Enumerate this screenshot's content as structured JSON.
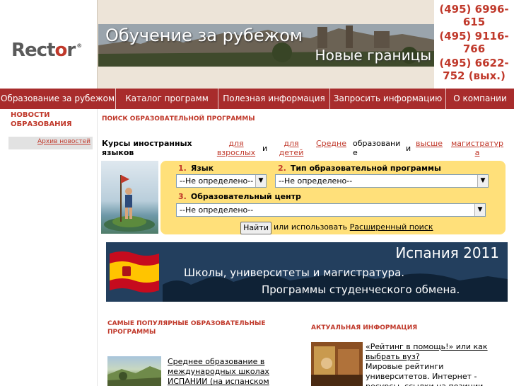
{
  "header": {
    "logo_text": "Rector",
    "banner_title": "Обучение за рубежом",
    "banner_subtitle": "Новые границы",
    "phones": [
      "(495) 6996-615",
      "(495) 9116-766",
      "(495) 6622-752 (вых.)"
    ]
  },
  "nav": {
    "items": [
      "Образование за рубежом",
      "Каталог программ",
      "Полезная информация",
      "Запросить информацию",
      "О компании"
    ]
  },
  "sidebar": {
    "news_title": "НОВОСТИ ОБРАЗОВАНИЯ",
    "archive_link": "Архив новостей"
  },
  "search": {
    "title": "ПОИСК ОБРАЗОВАТЕЛЬНОЙ ПРОГРАММЫ",
    "courses_label": "Курсы иностранных языков",
    "link_adults": "для взрослых",
    "and1": "и",
    "link_children": "для детей",
    "link_secondary": "Средне",
    "education_word": "образовани е",
    "and2": "и",
    "link_higher": "высше",
    "link_masters": "магистратур а",
    "field1_num": "1.",
    "field1_label": "Язык",
    "field1_value": "--Не определено--",
    "field2_num": "2.",
    "field2_label": "Тип образовательной программы",
    "field2_value": "--Не определено--",
    "field3_num": "3.",
    "field3_label": "Образовательный центр",
    "field3_value": "--Не определено--",
    "submit_label": "Найти",
    "or_text": "или использовать",
    "advanced_link": "Расширенный поиск"
  },
  "promo": {
    "title": "Испания 2011",
    "line1": "Школы, университеты и магистратура.",
    "line2": "Программы студенческого обмена."
  },
  "popular": {
    "title": "САМЫЕ ПОПУЛЯРНЫЕ ОБРАЗОВАТЕЛЬНЫЕ ПРОГРАММЫ",
    "item1": "Среднее образование в международных школах ИСПАНИИ (на испанском"
  },
  "actual": {
    "title": "АКТУАЛЬНАЯ ИНФОРМАЦИЯ",
    "item1_link": "«Рейтинг в помощь!» или как выбрать вуз?",
    "item1_text": "Мировые рейтинги университетов. Интернет - ресурсы, ссылки на позиции"
  },
  "colors": {
    "accent": "#c0392b",
    "nav_bg": "#a82c2c",
    "search_box": "#ffe07a",
    "header_bg": "#ede4d8"
  }
}
